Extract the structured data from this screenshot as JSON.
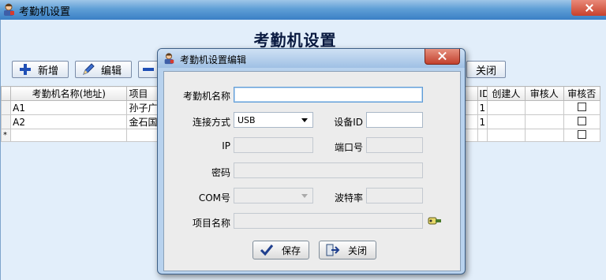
{
  "window": {
    "title": "考勤机设置"
  },
  "page": {
    "heading": "考勤机设置"
  },
  "toolbar": {
    "add": "新增",
    "edit": "编辑",
    "close": "关闭"
  },
  "grid": {
    "headers": [
      "考勤机名称(地址)",
      "项目",
      "ID",
      "创建人",
      "审核人",
      "审核否"
    ],
    "rows": [
      {
        "name": "A1",
        "project": "孙子广",
        "id": "1"
      },
      {
        "name": "A2",
        "project": "金石国",
        "id": "1"
      }
    ],
    "new_row_marker": "*"
  },
  "dialog": {
    "title": "考勤机设置编辑",
    "labels": {
      "device_name": "考勤机名称",
      "connection": "连接方式",
      "device_id": "设备ID",
      "ip": "IP",
      "port": "端口号",
      "password": "密码",
      "com": "COM号",
      "baud": "波特率",
      "project_name": "项目名称"
    },
    "values": {
      "device_name": "",
      "connection": "USB",
      "device_id": "",
      "ip": "",
      "port": "",
      "password": "",
      "com": "",
      "baud": "",
      "project_name": ""
    },
    "buttons": {
      "save": "保存",
      "close": "关闭"
    }
  },
  "colors": {
    "titlebar": "#5f9fd6",
    "dialog_frame": "#b8d2ee",
    "close_red": "#c7402b"
  },
  "icons": [
    "app-icon",
    "add-icon",
    "edit-icon",
    "remove-icon",
    "lookup-icon",
    "check-icon",
    "exit-icon"
  ]
}
